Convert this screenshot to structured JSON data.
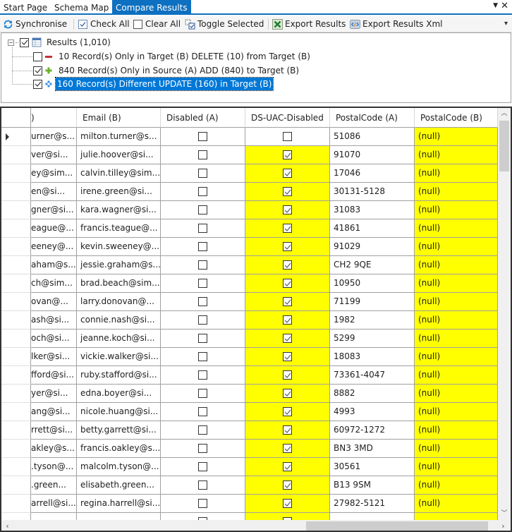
{
  "tabs": [
    {
      "label": "Start Page",
      "active": false
    },
    {
      "label": "Schema Map",
      "active": false
    },
    {
      "label": "Compare Results",
      "active": true
    }
  ],
  "tab_controls": {
    "menu_icon": "dropdown-arrow-icon",
    "close_icon": "close-icon"
  },
  "toolbar": {
    "synchronise": "Synchronise",
    "check_all": "Check All",
    "clear_all": "Clear All",
    "toggle_selected": "Toggle Selected",
    "export_results": "Export Results",
    "export_results_xml": "Export Results Xml"
  },
  "tree": {
    "root": {
      "label": "Results (1,010)",
      "checked": true,
      "expanded": true
    },
    "children": [
      {
        "label": "10 Record(s) Only in Target (B) DELETE (10) from Target (B)",
        "checked": false,
        "icon": "minus-icon",
        "selected": false
      },
      {
        "label": "840 Record(s) Only in Source (A) ADD (840) to Target (B)",
        "checked": true,
        "icon": "plus-icon",
        "selected": false
      },
      {
        "label": "160 Record(s) Different UPDATE (160) in Target (B)",
        "checked": true,
        "icon": "update-icon",
        "selected": true
      }
    ]
  },
  "grid": {
    "columns": [
      ")",
      "Email (B)",
      "Disabled (A)",
      "DS-UAC-Disabled",
      "PostalCode (A)",
      "PostalCode (B)"
    ],
    "rows": [
      {
        "email_a": "urner@s...",
        "email_b": "milton.turner@s...",
        "disabled_a": false,
        "ds_uac_disabled": false,
        "ds_diff": false,
        "postal_a": "51086",
        "postal_b": "(null)",
        "current": true
      },
      {
        "email_a": "ver@si...",
        "email_b": "julie.hoover@si...",
        "disabled_a": false,
        "ds_uac_disabled": true,
        "ds_diff": true,
        "postal_a": "91070",
        "postal_b": "(null)"
      },
      {
        "email_a": "ey@sim...",
        "email_b": "calvin.tilley@sim...",
        "disabled_a": false,
        "ds_uac_disabled": true,
        "ds_diff": true,
        "postal_a": "17046",
        "postal_b": "(null)"
      },
      {
        "email_a": "en@si...",
        "email_b": "irene.green@si...",
        "disabled_a": false,
        "ds_uac_disabled": true,
        "ds_diff": true,
        "postal_a": "30131-5128",
        "postal_b": "(null)"
      },
      {
        "email_a": "gner@si...",
        "email_b": "kara.wagner@si...",
        "disabled_a": false,
        "ds_uac_disabled": true,
        "ds_diff": true,
        "postal_a": "31083",
        "postal_b": "(null)"
      },
      {
        "email_a": "eague@...",
        "email_b": "francis.teague@...",
        "disabled_a": false,
        "ds_uac_disabled": true,
        "ds_diff": true,
        "postal_a": "41861",
        "postal_b": "(null)"
      },
      {
        "email_a": "eeney@...",
        "email_b": "kevin.sweeney@...",
        "disabled_a": false,
        "ds_uac_disabled": true,
        "ds_diff": true,
        "postal_a": "91029",
        "postal_b": "(null)"
      },
      {
        "email_a": "aham@s...",
        "email_b": "jessie.graham@s...",
        "disabled_a": false,
        "ds_uac_disabled": true,
        "ds_diff": true,
        "postal_a": "CH2 9QE",
        "postal_b": "(null)"
      },
      {
        "email_a": "ch@sim...",
        "email_b": "brad.beach@sim...",
        "disabled_a": false,
        "ds_uac_disabled": true,
        "ds_diff": true,
        "postal_a": "10950",
        "postal_b": "(null)"
      },
      {
        "email_a": "ovan@...",
        "email_b": "larry.donovan@...",
        "disabled_a": false,
        "ds_uac_disabled": true,
        "ds_diff": true,
        "postal_a": "71199",
        "postal_b": "(null)"
      },
      {
        "email_a": "ash@si...",
        "email_b": "connie.nash@si...",
        "disabled_a": false,
        "ds_uac_disabled": true,
        "ds_diff": true,
        "postal_a": "1982",
        "postal_b": "(null)"
      },
      {
        "email_a": "och@si...",
        "email_b": "jeanne.koch@si...",
        "disabled_a": false,
        "ds_uac_disabled": true,
        "ds_diff": true,
        "postal_a": "5299",
        "postal_b": "(null)"
      },
      {
        "email_a": "lker@si...",
        "email_b": "vickie.walker@si...",
        "disabled_a": false,
        "ds_uac_disabled": true,
        "ds_diff": true,
        "postal_a": "18083",
        "postal_b": "(null)"
      },
      {
        "email_a": "fford@si...",
        "email_b": "ruby.stafford@si...",
        "disabled_a": false,
        "ds_uac_disabled": true,
        "ds_diff": true,
        "postal_a": "73361-4047",
        "postal_b": "(null)"
      },
      {
        "email_a": "yer@si...",
        "email_b": "edna.boyer@si...",
        "disabled_a": false,
        "ds_uac_disabled": true,
        "ds_diff": true,
        "postal_a": "8882",
        "postal_b": "(null)"
      },
      {
        "email_a": "ang@si...",
        "email_b": "nicole.huang@si...",
        "disabled_a": false,
        "ds_uac_disabled": true,
        "ds_diff": true,
        "postal_a": "4993",
        "postal_b": "(null)"
      },
      {
        "email_a": "rrett@si...",
        "email_b": "betty.garrett@si...",
        "disabled_a": false,
        "ds_uac_disabled": true,
        "ds_diff": true,
        "postal_a": "60972-1272",
        "postal_b": "(null)"
      },
      {
        "email_a": "akley@s...",
        "email_b": "francis.oakley@s...",
        "disabled_a": false,
        "ds_uac_disabled": true,
        "ds_diff": true,
        "postal_a": "BN3 3MD",
        "postal_b": "(null)"
      },
      {
        "email_a": ".tyson@...",
        "email_b": "malcolm.tyson@...",
        "disabled_a": false,
        "ds_uac_disabled": true,
        "ds_diff": true,
        "postal_a": "30561",
        "postal_b": "(null)"
      },
      {
        "email_a": ".green...",
        "email_b": "elisabeth.green...",
        "disabled_a": false,
        "ds_uac_disabled": true,
        "ds_diff": true,
        "postal_a": "B13 9SM",
        "postal_b": "(null)"
      },
      {
        "email_a": "arrell@si...",
        "email_b": "regina.harrell@si...",
        "disabled_a": false,
        "ds_uac_disabled": true,
        "ds_diff": true,
        "postal_a": "27982-5121",
        "postal_b": "(null)"
      },
      {
        "email_a": "",
        "email_b": "",
        "disabled_a": false,
        "ds_uac_disabled": false,
        "ds_diff": true,
        "postal_a": "",
        "postal_b": "",
        "partial": true
      }
    ],
    "diff_color": "#ffff00"
  }
}
